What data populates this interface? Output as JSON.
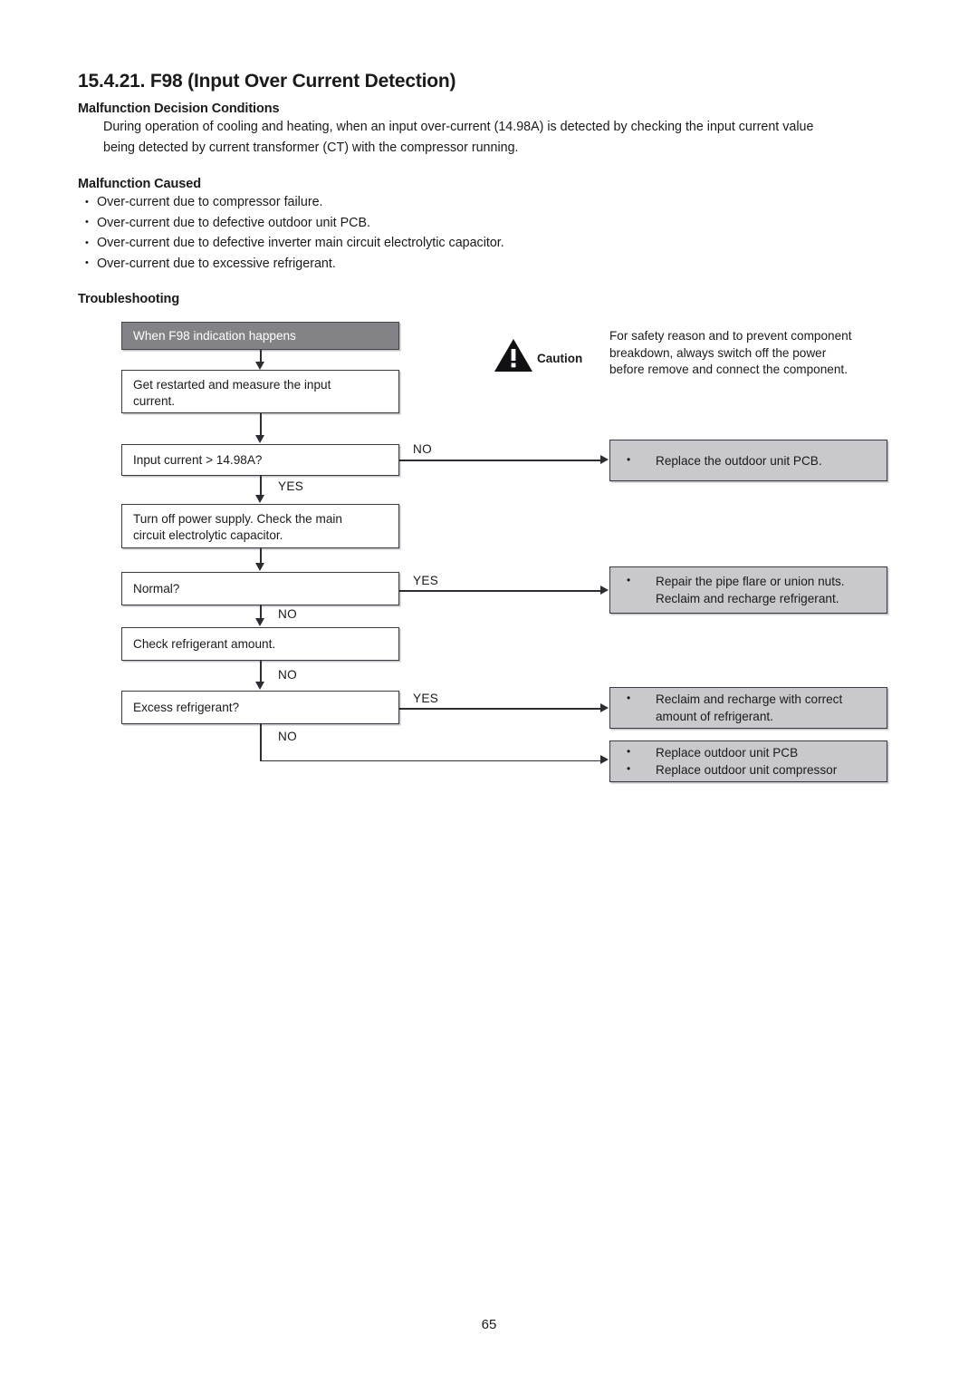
{
  "document": {
    "title": "15.4.21. F98 (Input Over Current Detection)",
    "page_number": "65"
  },
  "malfunction_decision": {
    "heading": "Malfunction Decision Conditions",
    "line1": "During operation of cooling and heating, when an input over-current (14.98A) is detected by checking the input current value",
    "line2": "being detected by current transformer (CT) with the compressor running."
  },
  "malfunction_caused": {
    "heading": "Malfunction Caused",
    "items": [
      "Over-current due to compressor failure.",
      "Over-current due to defective outdoor unit PCB.",
      "Over-current due to defective inverter main circuit electrolytic capacitor.",
      "Over-current due to excessive refrigerant."
    ]
  },
  "troubleshooting": {
    "heading": "Troubleshooting",
    "caution": {
      "word": "Caution",
      "line1": "For safety reason and to prevent component",
      "line2": "breakdown, always switch off the power",
      "line3": "before remove and connect the component."
    },
    "nodes": {
      "start": "When F98 indication happens",
      "step_restart_l1": "Get restarted and measure the input",
      "step_restart_l2": "current.",
      "decision_input_current": "Input current > 14.98A?",
      "step_power_off_l1": "Turn off power supply. Check the main",
      "step_power_off_l2": "circuit electrolytic capacitor.",
      "decision_normal": "Normal?",
      "step_check_refrigerant": "Check refrigerant amount.",
      "decision_excess_refrigerant": "Excess refrigerant?"
    },
    "actions": {
      "replace_pcb": "Replace the outdoor unit PCB.",
      "repair_pipe_l1": "Repair the pipe flare or union nuts.",
      "repair_pipe_l2": "Reclaim and recharge refrigerant.",
      "reclaim_l1": "Reclaim and recharge with correct",
      "reclaim_l2": "amount of refrigerant.",
      "replace_pcb2": "Replace outdoor unit PCB",
      "replace_compressor": "Replace outdoor unit compressor"
    },
    "branch_labels": {
      "input_no": "NO",
      "input_yes": "YES",
      "normal_yes": "YES",
      "normal_no": "NO",
      "check_no": "NO",
      "excess_yes": "YES",
      "excess_no": "NO"
    }
  },
  "colors": {
    "start_fill": "#828287",
    "action_fill": "#c9c9cd",
    "line": "#2c2c33"
  }
}
